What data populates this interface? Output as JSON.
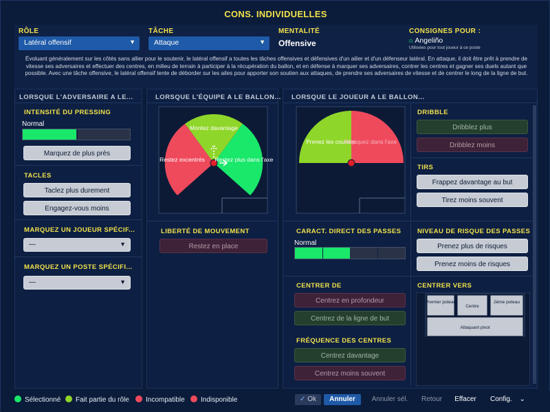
{
  "title": "CONS. INDIVIDUELLES",
  "header": {
    "role_label": "RÔLE",
    "role_value": "Latéral offensif",
    "task_label": "TÂCHE",
    "task_value": "Attaque",
    "mentality_label": "MENTALITÉ",
    "mentality_value": "Offensive",
    "instructions_for_label": "CONSIGNES POUR :",
    "player_name": "Angeliño",
    "player_note": "Utilisées pour tout joueur à ce poste"
  },
  "description": "Évoluant généralement sur les côtés sans allier pour le soutenir, le latéral offensif a toutes les tâches offensives et défensives d'un ailier et d'un défenseur latéral. En attaque, il doit être prêt à prendre de vitesse ses adversaires et effectuer des centres, en milieu de terrain à participer à la récupération du ballon, et en défense à marquer ses adversaires, contrer les centres et gagner ses duels autant que possible. Avec une tâche offensive, le latéral offensif tente de déborder sur les ailes pour apporter son soutien aux attaques, de prendre ses adversaires de vitesse et de centrer le long de la ligne de but.",
  "col1": {
    "title": "LORSQUE L'ADVERSAIRE A LE...",
    "pressing_label": "INTENSITÉ DU PRESSING",
    "pressing_value": "Normal",
    "pressing_level": 0.5,
    "pressing_button": "Marquez de plus près",
    "tackles_label": "TACLES",
    "tackle_hard": "Taclez plus durement",
    "tackle_less": "Engagez-vous moins",
    "mark_player_label": "MARQUEZ UN JOUEUR SPÉCIF...",
    "mark_player_value": "—",
    "mark_position_label": "MARQUEZ UN POSTE SPÉCIFI...",
    "mark_position_value": "—"
  },
  "col2": {
    "title": "LORSQUE L'ÉQUIPE A LE BALLON...",
    "zone_forward": "Montez davantage",
    "zone_wide": "Restez excentrés",
    "zone_inside": "Restez plus dans l'axe",
    "freedom_label": "LIBERTÉ DE MOUVEMENT",
    "freedom_button": "Restez en place"
  },
  "col3": {
    "title": "LORSQUE LE JOUEUR A LE BALLON...",
    "zone_wide": "Prenez les couloirs",
    "zone_inside": "Repiquez dans l'axe",
    "dribble_label": "DRIBBLE",
    "dribble_more": "Dribblez plus",
    "dribble_less": "Dribblez moins",
    "shots_label": "TIRS",
    "shoot_more": "Frappez davantage au but",
    "shoot_less": "Tirez moins souvent",
    "pass_label": "CARACT. DIRECT DES PASSES",
    "pass_value": "Normal",
    "pass_level": 0.5,
    "risk_label": "NIVEAU DE RISQUE DES PASSES",
    "risk_more": "Prenez plus de risques",
    "risk_less": "Prenez moins de risques",
    "cross_from_label": "CENTRER DE",
    "cross_deep": "Centrez en profondeur",
    "cross_byline": "Centrez de la ligne de but",
    "cross_to_label": "CENTRER VERS",
    "cross_near": "Premier poteau",
    "cross_centre": "Centre",
    "cross_far": "2ème poteau",
    "cross_target": "Attaquant pivot",
    "cross_freq_label": "FRÉQUENCE DES CENTRES",
    "cross_more": "Centrez davantage",
    "cross_less": "Centrez moins souvent"
  },
  "legend": [
    {
      "label": "Sélectionné",
      "color": "#19e86a"
    },
    {
      "label": "Fait partie du rôle",
      "color": "#8fd62a"
    },
    {
      "label": "Incompatible",
      "color": "#ef4a5c"
    },
    {
      "label": "Indisponible",
      "color": "#ef4a5c"
    }
  ],
  "footer": {
    "ok": "Ok",
    "cancel": "Annuler",
    "cancel_sel": "Annuler sél.",
    "back": "Retour",
    "clear": "Effacer",
    "config": "Config."
  },
  "colors": {
    "accent_yellow": "#f2e24b",
    "selected_green": "#19e86a",
    "role_green": "#8fd62a",
    "incompatible_red": "#ef4a5c",
    "select_blue": "#1e5aa8"
  }
}
